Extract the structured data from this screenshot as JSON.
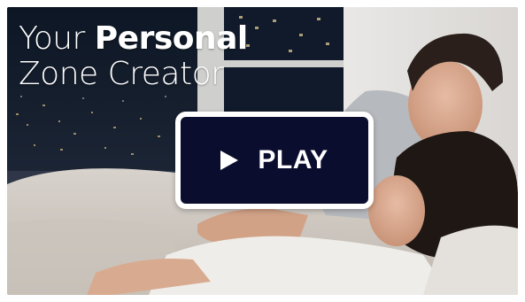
{
  "video": {
    "headline_line1_thin": "Your ",
    "headline_line1_bold": "Personal",
    "headline_line2": "Zone Creator",
    "play_label": "PLAY",
    "play_icon": "play-triangle-icon"
  },
  "colors": {
    "button_bg": "#0b0d2e",
    "button_border": "#ffffff",
    "text": "#ffffff"
  }
}
